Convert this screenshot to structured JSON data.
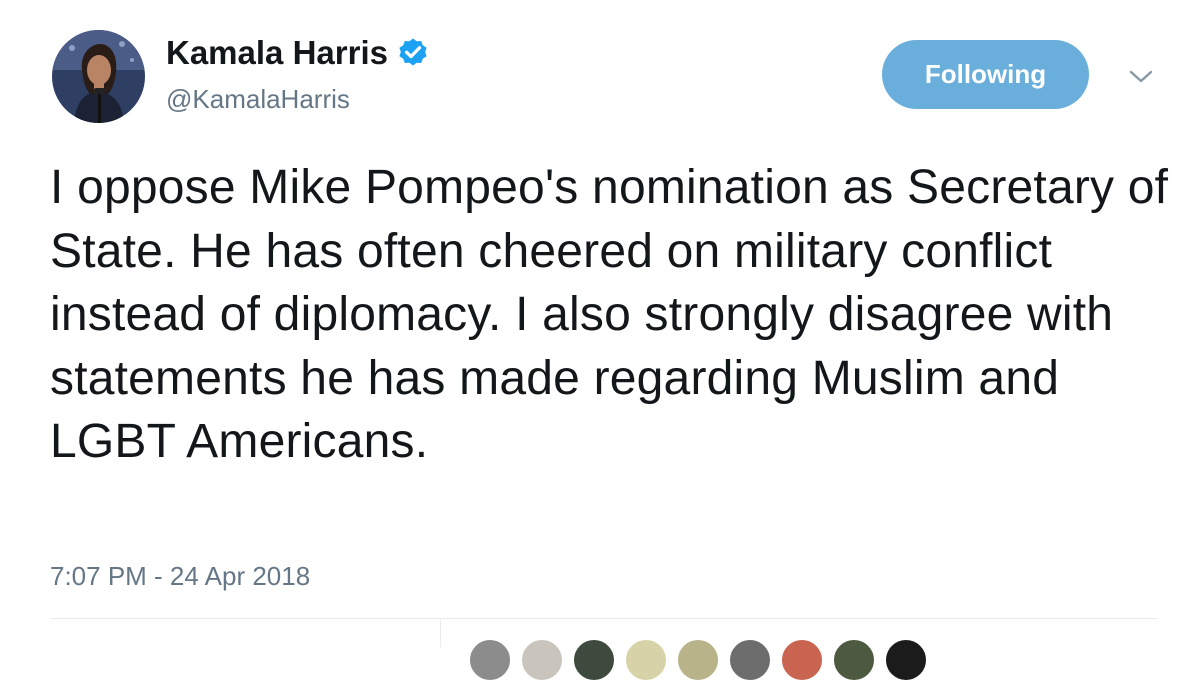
{
  "author": {
    "display_name": "Kamala Harris",
    "handle": "@KamalaHarris",
    "verified_icon": "verified-badge-icon",
    "avatar_icon": "profile-photo"
  },
  "follow_button": {
    "label": "Following",
    "color": "#6aaedb"
  },
  "menu": {
    "icon": "chevron-down-icon"
  },
  "tweet": {
    "text": "I oppose Mike Pompeo's nomination as Secretary of State. He has often cheered on military conflict instead of diplomacy. I also strongly disagree with statements he has made regarding Muslim and LGBT Americans.",
    "timestamp": "7:07 PM - 24 Apr 2018"
  },
  "colors": {
    "text": "#14171a",
    "secondary_text": "#657786",
    "verified_blue": "#1da1f2",
    "divider": "#e6ecf0"
  },
  "liker_avatar_colors": [
    "#8c8c8c",
    "#c9c4bc",
    "#3e4a3d",
    "#d8d2a8",
    "#b9b38a",
    "#6d6d6d",
    "#c86450",
    "#4d5a40",
    "#1b1b1b"
  ]
}
